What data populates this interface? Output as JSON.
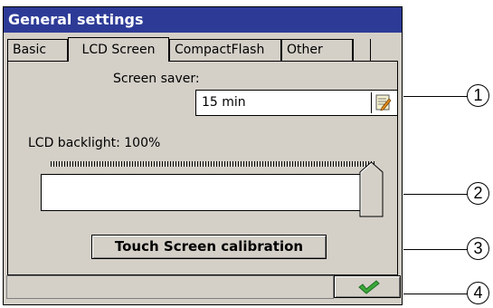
{
  "window": {
    "title": "General settings"
  },
  "tabs": [
    {
      "label": "Basic"
    },
    {
      "label": "LCD Screen"
    },
    {
      "label": "CompactFlash"
    },
    {
      "label": "Other"
    }
  ],
  "active_tab": "LCD Screen",
  "screen_saver": {
    "label": "Screen saver:",
    "value": "15 min",
    "icon": "edit-notepad-icon"
  },
  "backlight": {
    "label": "LCD backlight: 100%",
    "level_percent": 100
  },
  "touch_calibration_button": {
    "label": "Touch Screen calibration"
  },
  "ok_button": {
    "icon": "checkmark-icon",
    "color": "#3aa83a"
  },
  "callouts": [
    "1",
    "2",
    "3",
    "4"
  ],
  "colors": {
    "title_bar": "#2d3b97",
    "window_bg": "#d4d0c8"
  }
}
